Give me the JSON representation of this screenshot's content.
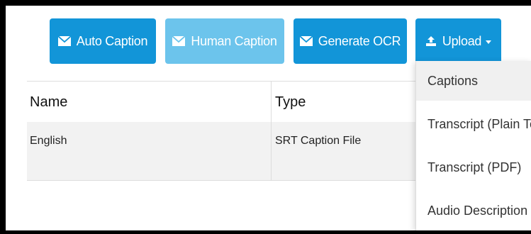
{
  "toolbar": {
    "auto_caption": "Auto Caption",
    "human_caption": "Human Caption",
    "generate_ocr": "Generate OCR",
    "upload": "Upload"
  },
  "table": {
    "columns": [
      "Name",
      "Type"
    ],
    "rows": [
      [
        "English",
        "SRT Caption File"
      ]
    ]
  },
  "upload_menu": {
    "items": [
      "Captions",
      "Transcript (Plain Text",
      "Transcript (PDF)",
      "Audio Description"
    ],
    "active_index": 0
  },
  "colors": {
    "primary": "#1295d8",
    "primary_disabled": "#6cc4ec",
    "row_bg": "#f2f2f2"
  },
  "icons": {
    "caption_buttons": "envelope-icon",
    "upload": "upload-icon",
    "dropdown": "caret-down-icon"
  }
}
